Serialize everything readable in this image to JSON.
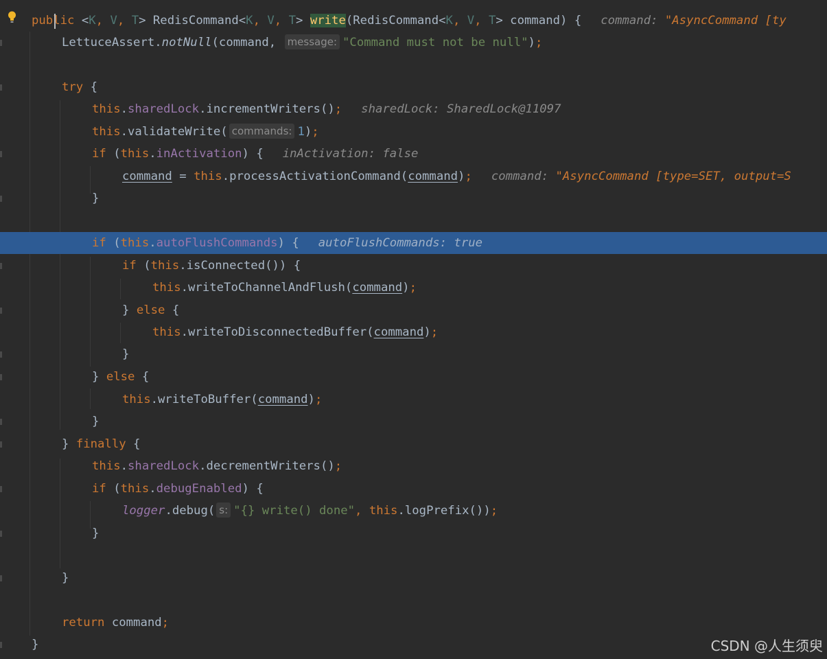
{
  "editor": {
    "line1": {
      "kw": "public",
      "sig_a": " <",
      "tK": "K",
      "c1": ", ",
      "tV": "V",
      "c2": ", ",
      "tT": "T",
      "sig_b": "> RedisCommand<",
      "tK2": "K",
      "c3": ", ",
      "tV2": "V",
      "c4": ", ",
      "tT2": "T",
      "sig_c": "> ",
      "method": "write",
      "sig_d": "(RedisCommand<",
      "tK3": "K",
      "c5": ", ",
      "tV3": "V",
      "c6": ", ",
      "tT3": "T",
      "sig_e": "> command) {",
      "dbg_label": "command:",
      "dbg_value": "\"AsyncCommand [ty"
    },
    "line2": {
      "cls": "LettuceAssert.",
      "call": "notNull",
      "open": "(command,",
      "hint": "message:",
      "str": "\"Command must not be null\"",
      "close": ")",
      "semi": ";"
    },
    "line4": {
      "kw": "try",
      "rest": " {"
    },
    "line5": {
      "this": "this",
      "dot": ".",
      "fld": "sharedLock",
      "call": ".incrementWriters()",
      "semi": ";",
      "dbg_label": "sharedLock:",
      "dbg_value": "SharedLock@11097"
    },
    "line6": {
      "this": "this",
      "call": ".validateWrite(",
      "hint": "commands:",
      "num": "1",
      "close": ")",
      "semi": ";"
    },
    "line7": {
      "kw": "if",
      "open": " (",
      "this": "this",
      "dot": ".",
      "fld": "inActivation",
      "close": ") {",
      "dbg_label": "inActivation:",
      "dbg_value": "false"
    },
    "line8": {
      "var": "command",
      "eq": " = ",
      "this": "this",
      "call": ".processActivationCommand(",
      "arg": "command",
      "close": ")",
      "semi": ";",
      "dbg_label": "command:",
      "dbg_value": "\"AsyncCommand [type=SET, output=S"
    },
    "line9": {
      "text": "}"
    },
    "line11": {
      "kw": "if",
      "open": " (",
      "this": "this",
      "dot": ".",
      "fld": "autoFlushCommands",
      "close": ") {",
      "dbg_label": "autoFlushCommands:",
      "dbg_value": "true"
    },
    "line12": {
      "kw": "if",
      "open": " (",
      "this": "this",
      "call": ".isConnected()) {"
    },
    "line13": {
      "this": "this",
      "call": ".writeToChannelAndFlush(",
      "arg": "command",
      "close": ")",
      "semi": ";"
    },
    "line14": {
      "brace": "} ",
      "kw": "else",
      "rest": " {"
    },
    "line15": {
      "this": "this",
      "call": ".writeToDisconnectedBuffer(",
      "arg": "command",
      "close": ")",
      "semi": ";"
    },
    "line16": {
      "text": "}"
    },
    "line17": {
      "brace": "} ",
      "kw": "else",
      "rest": " {"
    },
    "line18": {
      "this": "this",
      "call": ".writeToBuffer(",
      "arg": "command",
      "close": ")",
      "semi": ";"
    },
    "line19": {
      "text": "}"
    },
    "line20": {
      "brace": "} ",
      "kw": "finally",
      "rest": " {"
    },
    "line21": {
      "this": "this",
      "dot": ".",
      "fld": "sharedLock",
      "call": ".decrementWriters()",
      "semi": ";"
    },
    "line22": {
      "kw": "if",
      "open": " (",
      "this": "this",
      "dot": ".",
      "fld": "debugEnabled",
      "close": ") {"
    },
    "line23": {
      "obj": "logger",
      "call": ".debug(",
      "hint": "s:",
      "str": "\"{} write() done\"",
      "comma": ", ",
      "this": "this",
      "call2": ".logPrefix())",
      "semi": ";"
    },
    "line24": {
      "text": "}"
    },
    "line26": {
      "text": "}"
    },
    "line28": {
      "kw": "return",
      "rest": " command",
      "semi": ";"
    },
    "line29": {
      "text": "}"
    }
  },
  "watermark": "CSDN @人生须臾"
}
